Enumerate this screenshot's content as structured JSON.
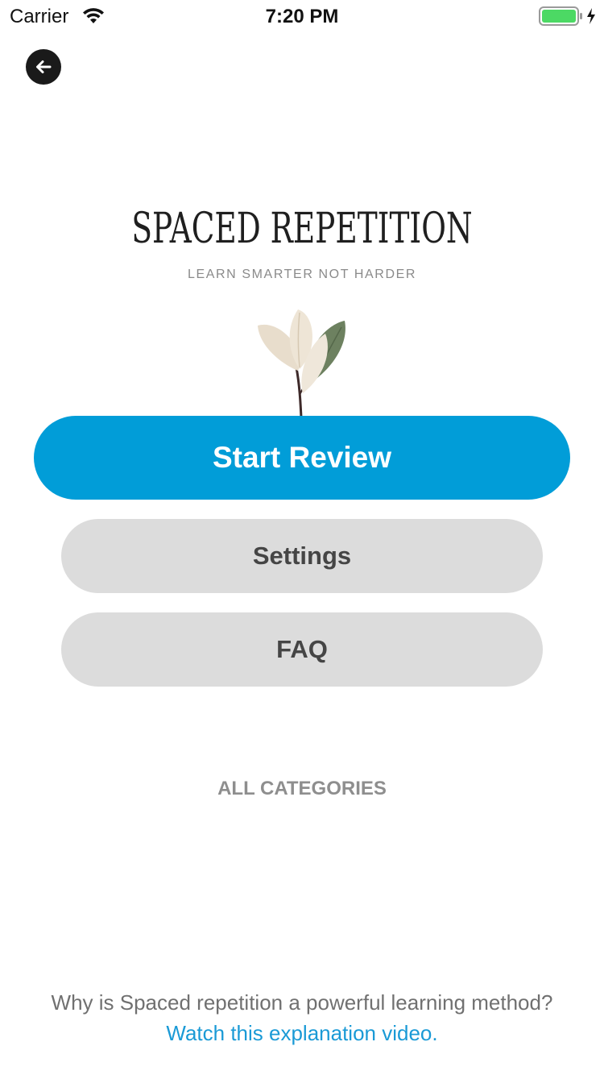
{
  "status_bar": {
    "carrier": "Carrier",
    "time": "7:20 PM",
    "battery_color": "#4cd964",
    "icons": [
      "wifi-icon",
      "battery-icon",
      "charging-icon"
    ]
  },
  "nav": {
    "back_icon": "arrow-left-icon"
  },
  "logo": {
    "title": "SPACED REPETITION",
    "tagline": "LEARN SMARTER NOT HARDER",
    "illustration": "leaf-sprig-illustration"
  },
  "buttons": {
    "start_review": "Start Review",
    "settings": "Settings",
    "faq": "FAQ"
  },
  "categories": {
    "label": "ALL CATEGORIES"
  },
  "footer": {
    "question": "Why is Spaced repetition a powerful learning method?",
    "link": "Watch this explanation video."
  },
  "colors": {
    "primary": "#019dd8",
    "secondary_button": "#dcdcdc",
    "link": "#1a9ad6"
  }
}
